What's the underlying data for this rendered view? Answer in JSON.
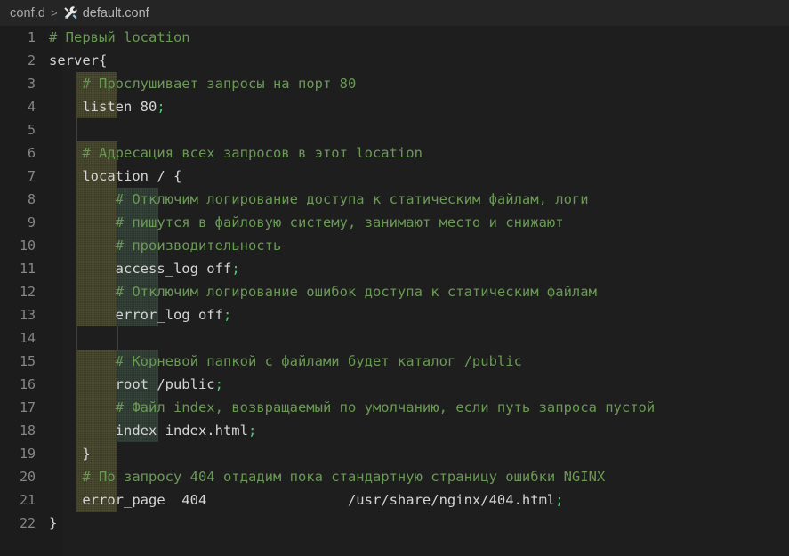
{
  "breadcrumb": {
    "folder": "conf.d",
    "separator": ">",
    "file": "default.conf",
    "icon": "tools-icon"
  },
  "editor": {
    "language": "nginx",
    "colors": {
      "background": "#1e1e1e",
      "gutter_background": "#1c1c1c",
      "line_number": "#868686",
      "text": "#d4d4d4",
      "comment": "#6a9955",
      "punctuation": "#4ec973",
      "indent_guide_level1": "#4d4d30",
      "indent_guide_level2": "#35453a",
      "breadcrumb_background": "#252526",
      "breadcrumb_text": "#a9a9a9"
    },
    "lines": [
      {
        "n": "1",
        "indent": 0,
        "segments": [
          {
            "t": "# Первый location",
            "c": "cmt"
          }
        ]
      },
      {
        "n": "2",
        "indent": 0,
        "segments": [
          {
            "t": "server",
            "c": "kw"
          },
          {
            "t": "{",
            "c": "brc"
          }
        ]
      },
      {
        "n": "3",
        "indent": 1,
        "segments": [
          {
            "t": "    # Прослушивает запросы на порт 80",
            "c": "cmt"
          }
        ]
      },
      {
        "n": "4",
        "indent": 1,
        "segments": [
          {
            "t": "    listen 80",
            "c": "kw"
          },
          {
            "t": ";",
            "c": "pun"
          }
        ]
      },
      {
        "n": "5",
        "indent": 0,
        "guides": 1,
        "segments": [
          {
            "t": "",
            "c": "kw"
          }
        ]
      },
      {
        "n": "6",
        "indent": 1,
        "segments": [
          {
            "t": "    # Адресация всех запросов в этот location",
            "c": "cmt"
          }
        ]
      },
      {
        "n": "7",
        "indent": 1,
        "segments": [
          {
            "t": "    location / {",
            "c": "kw"
          }
        ]
      },
      {
        "n": "8",
        "indent": 2,
        "segments": [
          {
            "t": "        # Отключим логирование доступа к статическим файлам, логи",
            "c": "cmt"
          }
        ]
      },
      {
        "n": "9",
        "indent": 2,
        "segments": [
          {
            "t": "        # пишутся в файловую систему, занимают место и снижают",
            "c": "cmt"
          }
        ]
      },
      {
        "n": "10",
        "indent": 2,
        "segments": [
          {
            "t": "        # производительность",
            "c": "cmt"
          }
        ]
      },
      {
        "n": "11",
        "indent": 2,
        "segments": [
          {
            "t": "        access_log off",
            "c": "kw"
          },
          {
            "t": ";",
            "c": "pun"
          }
        ]
      },
      {
        "n": "12",
        "indent": 2,
        "segments": [
          {
            "t": "        # Отключим логирование ошибок доступа к статическим файлам",
            "c": "cmt"
          }
        ]
      },
      {
        "n": "13",
        "indent": 2,
        "segments": [
          {
            "t": "        error_log off",
            "c": "kw"
          },
          {
            "t": ";",
            "c": "pun"
          }
        ]
      },
      {
        "n": "14",
        "indent": 0,
        "guides": 2,
        "segments": [
          {
            "t": "",
            "c": "kw"
          }
        ]
      },
      {
        "n": "15",
        "indent": 2,
        "segments": [
          {
            "t": "        # Корневой папкой с файлами будет каталог /public",
            "c": "cmt"
          }
        ]
      },
      {
        "n": "16",
        "indent": 2,
        "segments": [
          {
            "t": "        root /public",
            "c": "kw"
          },
          {
            "t": ";",
            "c": "pun"
          }
        ]
      },
      {
        "n": "17",
        "indent": 2,
        "segments": [
          {
            "t": "        # Файл index, возвращаемый по умолчанию, если путь запроса пустой",
            "c": "cmt"
          }
        ]
      },
      {
        "n": "18",
        "indent": 2,
        "segments": [
          {
            "t": "        index index.html",
            "c": "kw"
          },
          {
            "t": ";",
            "c": "pun"
          }
        ]
      },
      {
        "n": "19",
        "indent": 1,
        "segments": [
          {
            "t": "    }",
            "c": "brc"
          }
        ]
      },
      {
        "n": "20",
        "indent": 1,
        "segments": [
          {
            "t": "    # По запросу 404 отдадим пока стандартную страницу ошибки NGINX",
            "c": "cmt"
          }
        ]
      },
      {
        "n": "21",
        "indent": 1,
        "segments": [
          {
            "t": "    error_page  404                 /usr/share/nginx/404.html",
            "c": "kw"
          },
          {
            "t": ";",
            "c": "pun"
          }
        ]
      },
      {
        "n": "22",
        "indent": 0,
        "segments": [
          {
            "t": "}",
            "c": "brc"
          }
        ]
      }
    ]
  }
}
